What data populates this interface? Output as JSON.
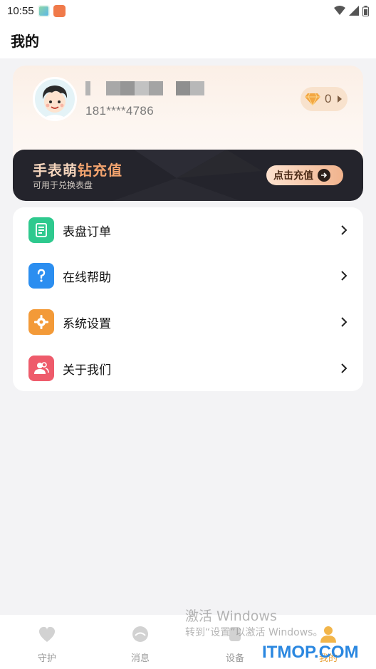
{
  "status_bar": {
    "time": "10:55",
    "icons": [
      "gallery-icon",
      "app-icon",
      "wifi-icon",
      "signal-icon",
      "battery-icon"
    ]
  },
  "header": {
    "title": "我的"
  },
  "profile": {
    "nickname_hidden": true,
    "phone": "181****4786",
    "diamond_count": "0",
    "avatar": "avatar-cartoon-boy"
  },
  "banner": {
    "title_part1": "手表萌",
    "title_part2": "钻充值",
    "subtitle": "可用于兑换表盘",
    "button_label": "点击充值",
    "colors": {
      "bg": "#24242c",
      "accent": "#f2a36e"
    }
  },
  "menu": {
    "items": [
      {
        "label": "表盘订单",
        "icon": "document-icon",
        "color": "#2ec98e"
      },
      {
        "label": "在线帮助",
        "icon": "question-icon",
        "color": "#2b8ef0"
      },
      {
        "label": "系统设置",
        "icon": "gear-icon",
        "color": "#f39a38"
      },
      {
        "label": "关于我们",
        "icon": "users-icon",
        "color": "#ee5b6b"
      }
    ]
  },
  "bottom_nav": {
    "items": [
      {
        "label": "守护",
        "icon": "heart-icon"
      },
      {
        "label": "消息",
        "icon": "message-icon"
      },
      {
        "label": "设备",
        "icon": "device-icon"
      },
      {
        "label": "我的",
        "icon": "person-icon",
        "active": true
      }
    ]
  },
  "watermarks": {
    "windows_title": "激活 Windows",
    "windows_sub": "转到“设置”以激活 Windows。",
    "site": "ITMOP.COM"
  }
}
